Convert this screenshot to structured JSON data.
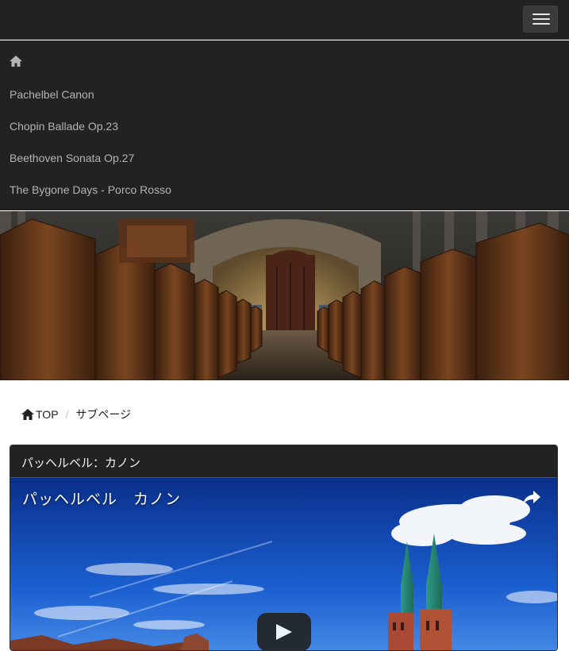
{
  "menu": {
    "items": [
      {
        "label": "Pachelbel Canon"
      },
      {
        "label": "Chopin Ballade Op.23"
      },
      {
        "label": "Beethoven Sonata Op.27"
      },
      {
        "label": "The Bygone Days - Porco Rosso"
      }
    ]
  },
  "breadcrumb": {
    "top": "TOP",
    "separator": "/",
    "current": "サブページ"
  },
  "card": {
    "header": "パッヘルベル：カノン",
    "video_title": "パッヘルベル　カノン"
  },
  "icons": {
    "menu_toggle": "hamburger-icon",
    "home": "home-icon",
    "share": "share-icon",
    "play": "play-icon"
  },
  "colors": {
    "navbar_bg": "#222222",
    "menu_text": "#b4b4b4",
    "sky": "#1a5fd0"
  }
}
